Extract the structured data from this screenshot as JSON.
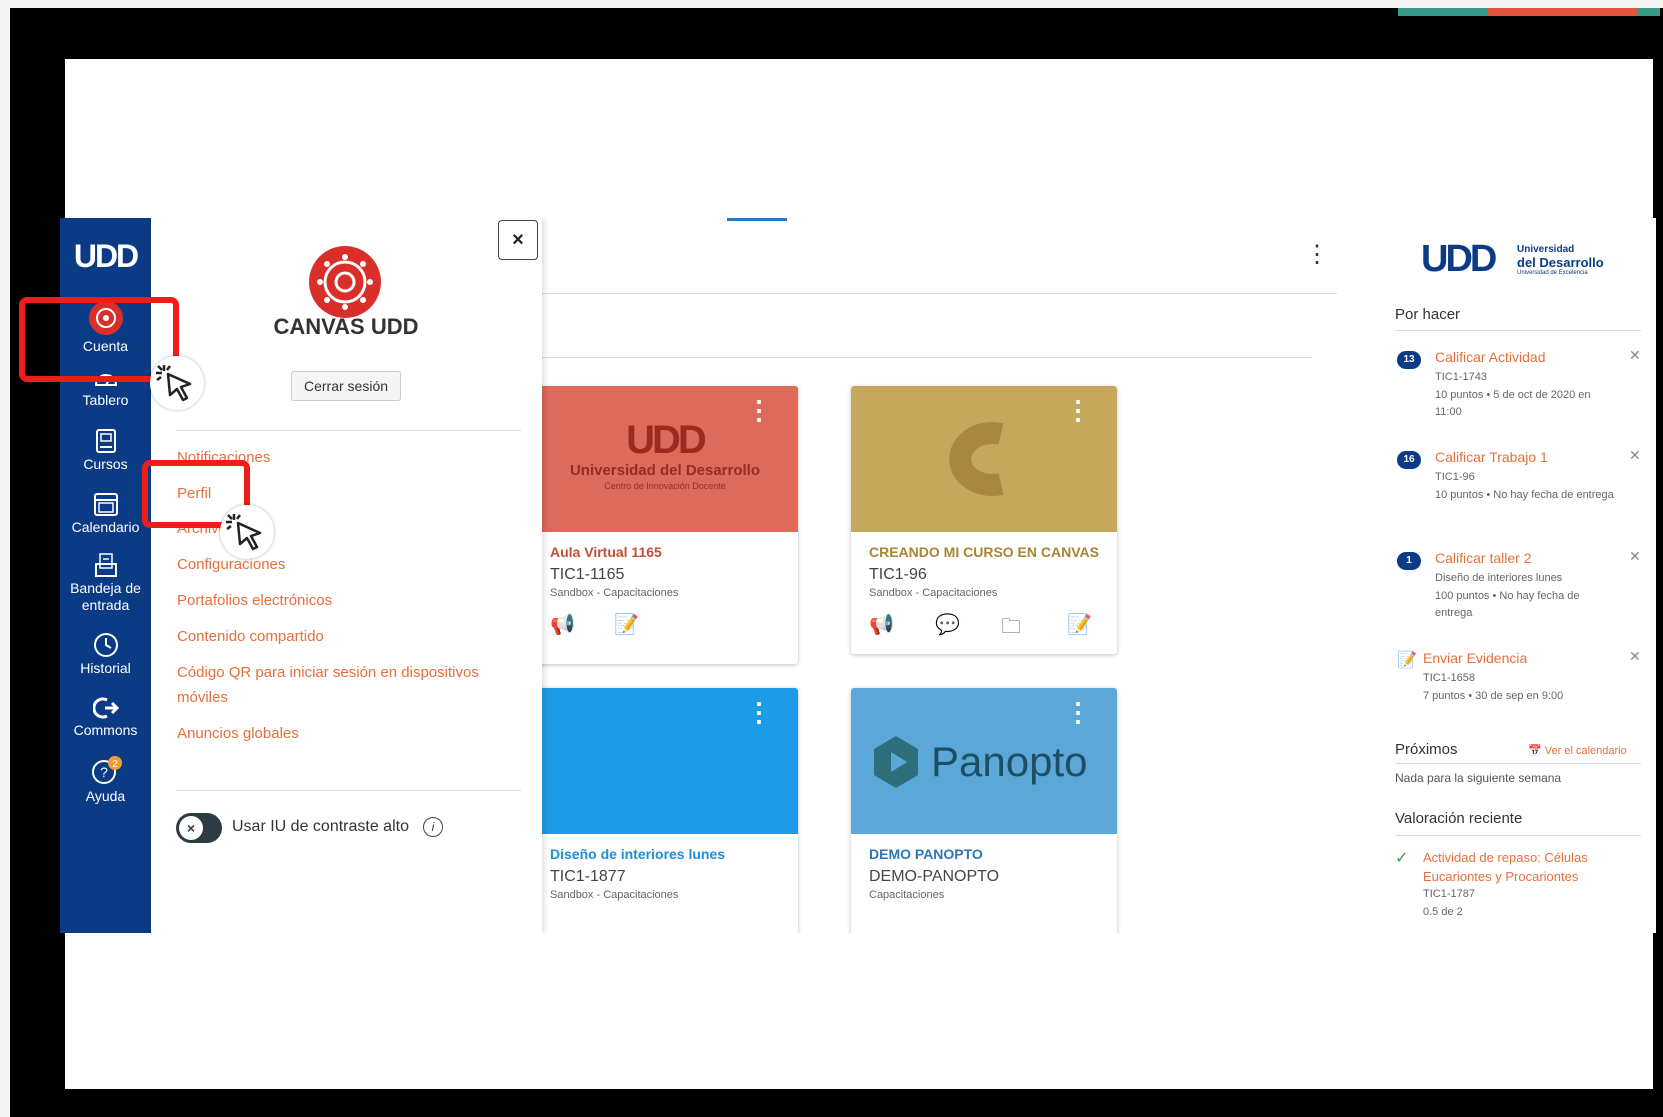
{
  "nav": {
    "logo": "UDD",
    "items": [
      {
        "label": "Cuenta",
        "icon": "account-avatar-icon"
      },
      {
        "label": "Tablero",
        "icon": "dashboard-icon"
      },
      {
        "label": "Cursos",
        "icon": "courses-icon"
      },
      {
        "label": "Calendario",
        "icon": "calendar-icon"
      },
      {
        "label": "Bandeja de entrada",
        "icon": "inbox-icon"
      },
      {
        "label": "Historial",
        "icon": "history-icon"
      },
      {
        "label": "Commons",
        "icon": "commons-icon"
      },
      {
        "label": "Ayuda",
        "icon": "help-icon",
        "badge": "2"
      }
    ]
  },
  "account_tray": {
    "close_label": "×",
    "name": "CANVAS UDD",
    "logout_label": "Cerrar sesión",
    "links": [
      "Notificaciones",
      "Perfil",
      "Archivos",
      "Configuraciones",
      "Portafolios electrónicos",
      "Contenido compartido",
      "Código QR para iniciar sesión en dispositivos móviles",
      "Anuncios globales"
    ],
    "toggle_label": "Usar IU de contraste alto",
    "toggle_knob": "×",
    "info_label": "i"
  },
  "cards": [
    {
      "title": "Aula Virtual 1165",
      "code": "TIC1-1165",
      "term": "Sandbox - Capacitaciones",
      "hero_color": "#dd6a5a",
      "title_color": "#c24e37",
      "hero_text": "UDD",
      "hero_sub": "Universidad del Desarrollo",
      "hero_sub2": "Centro de Innovación Docente"
    },
    {
      "title": "CREANDO MI CURSO EN CANVAS",
      "code": "TIC1-96",
      "term": "Sandbox - Capacitaciones",
      "hero_color": "#c6a85c",
      "title_color": "#a98433"
    },
    {
      "title": "Diseño de interiores lunes",
      "code": "TIC1-1877",
      "term": "Sandbox - Capacitaciones",
      "hero_color": "#1e9be6",
      "title_color": "#1e8fd6"
    },
    {
      "title": "DEMO PANOPTO",
      "code": "DEMO-PANOPTO",
      "term": "Capacitaciones",
      "hero_color": "#5ba8d8",
      "title_color": "#2b78b8",
      "hero_text": "Panopto"
    }
  ],
  "sidebar": {
    "brand_main": "UDD",
    "brand_line1": "Universidad",
    "brand_line2": "del Desarrollo",
    "brand_line3": "Universidad de Excelencia",
    "todo_heading": "Por hacer",
    "todos": [
      {
        "badge": "13",
        "title": "Calificar Actividad",
        "course": "TIC1-1743",
        "detail": "10 puntos • 5 de oct de 2020 en 11:00"
      },
      {
        "badge": "16",
        "title": "Calificar Trabajo 1",
        "course": "TIC1-96",
        "detail": "10 puntos • No hay fecha de entrega"
      },
      {
        "badge": "1",
        "title": "Calificar taller 2",
        "course": "Diseño de interiores lunes",
        "detail": "100 puntos • No hay fecha de entrega"
      },
      {
        "badge": "",
        "title": "Enviar Evidencia",
        "course": "TIC1-1658",
        "detail": "7 puntos • 30 de sep en 9:00"
      }
    ],
    "upcoming_heading": "Próximos",
    "calendar_link": "Ver el calendario",
    "upcoming_empty": "Nada para la siguiente semana",
    "recent_heading": "Valoración reciente",
    "recent_title": "Actividad de repaso: Células Eucariontes y Procariontes",
    "recent_course": "TIC1-1787",
    "recent_score": "0.5 de 2"
  },
  "colors": {
    "nav": "#0b3b84",
    "link": "#e66f3c",
    "highlight": "#ef1c1c",
    "avatar": "#d92f2b"
  }
}
